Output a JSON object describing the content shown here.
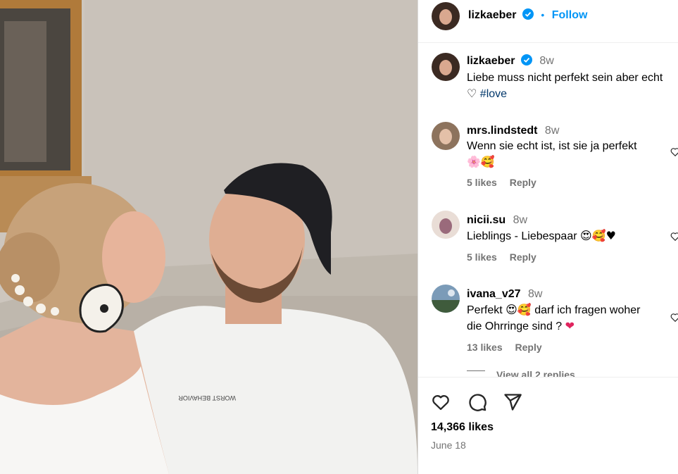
{
  "post": {
    "author": "lizkaeber",
    "follow_label": "Follow",
    "dot": "•",
    "caption_time": "8w",
    "caption_line1": "Liebe muss nicht perfekt sein aber echt",
    "caption_heart": "♡",
    "caption_hashtag": "#love"
  },
  "comments": [
    {
      "user": "mrs.lindstedt",
      "time": "8w",
      "line1": "Wenn sie echt ist, ist sie ja perfekt",
      "line2": "🌸🥰",
      "likes": "5 likes",
      "reply": "Reply"
    },
    {
      "user": "nicii.su",
      "time": "8w",
      "line1": "Lieblings - Liebespaar",
      "emoji": "😍🥰♥",
      "likes": "5 likes",
      "reply": "Reply"
    },
    {
      "user": "ivana_v27",
      "time": "8w",
      "line1a": "Perfekt",
      "emoji1": "😍🥰",
      "line1b": "darf ich fragen woher",
      "line2": "die Ohrringe sind ?",
      "emoji2": "❤",
      "likes": "13 likes",
      "reply": "Reply"
    }
  ],
  "view_replies": "View all 2 replies",
  "actions": {
    "likes": "14,366 likes",
    "date": "June 18"
  },
  "photo_text": {
    "shirt_print": "WORST BEHAVIOR"
  },
  "colors": {
    "accent": "#0095f6",
    "verified": "#0095f6",
    "hashtag": "#00376b",
    "muted": "#737373"
  },
  "icons": [
    "like-icon",
    "comment-icon",
    "share-icon",
    "verified-badge-icon",
    "heart-outline-icon"
  ]
}
